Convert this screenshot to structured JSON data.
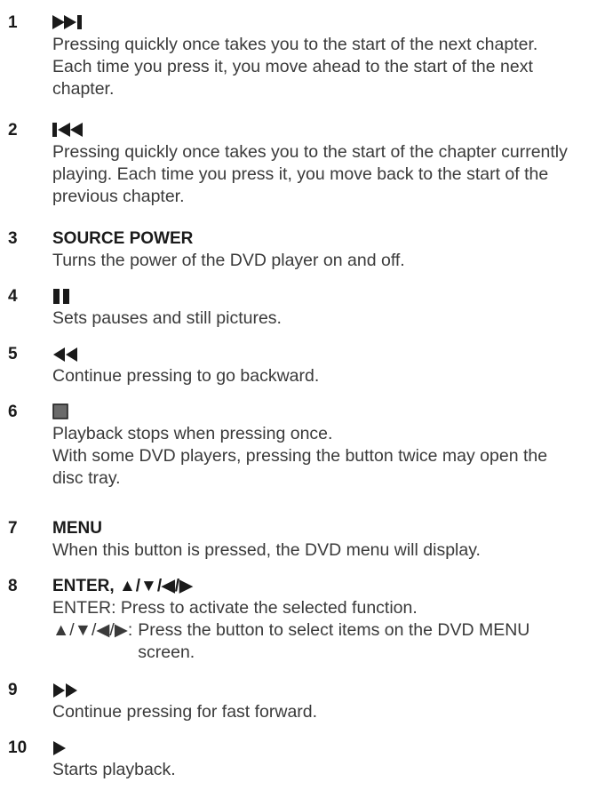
{
  "items": [
    {
      "number": "1",
      "icon": "skip-next-icon",
      "text": "Pressing quickly once takes you to the start of the next chapter. Each time you press it, you move ahead to the start of the next chapter."
    },
    {
      "number": "2",
      "icon": "skip-previous-icon",
      "text": "Pressing quickly once takes you to the start of the chapter currently playing. Each time you press it, you move back to the start of the previous chapter."
    },
    {
      "number": "3",
      "title": "SOURCE POWER",
      "text": "Turns the power of the DVD player on and off."
    },
    {
      "number": "4",
      "icon": "pause-icon",
      "text": "Sets pauses and still pictures."
    },
    {
      "number": "5",
      "icon": "rewind-icon",
      "text": "Continue pressing to go backward."
    },
    {
      "number": "6",
      "icon": "stop-icon",
      "text_lines": [
        "Playback stops when pressing once.",
        "With some DVD players, pressing the button twice may open the disc tray."
      ]
    },
    {
      "number": "7",
      "title": "MENU",
      "text": "When this button is pressed, the DVD menu will display."
    },
    {
      "number": "8",
      "title": "ENTER, ▲/▼/◀/▶",
      "enter_line": "ENTER: Press to activate the selected function.",
      "arrows_label": "▲/▼/◀/▶:",
      "arrows_text": "Press the button to select items on the DVD MENU screen."
    },
    {
      "number": "9",
      "icon": "fast-forward-icon",
      "text": "Continue pressing for fast forward."
    },
    {
      "number": "10",
      "icon": "play-icon",
      "text": "Starts playback."
    }
  ]
}
